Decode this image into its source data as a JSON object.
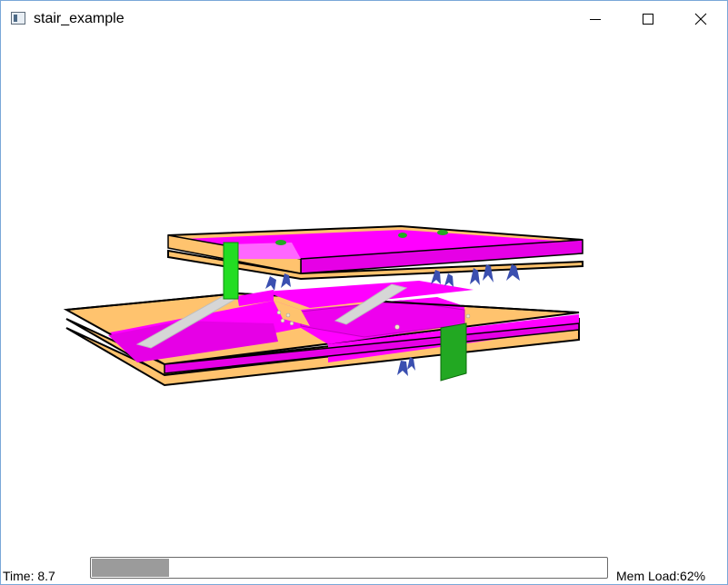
{
  "window": {
    "title": "stair_example"
  },
  "icons": {
    "app": "app-window-icon",
    "minimize": "minimize-icon",
    "maximize": "maximize-icon",
    "close": "close-icon"
  },
  "status": {
    "time_label": "Time: 8.7",
    "mem_label": "Mem Load:62%",
    "progress_fraction": 0.15
  },
  "scene": {
    "description_colors": {
      "floor_slab": "#ff00ff",
      "floor_slab_top": "#e600e6",
      "tile_orange": "#ffc36e",
      "stair_grey": "#d6d6d6",
      "door_green": "#22cc22",
      "agent_blue": "#3a4fb0",
      "outline": "#000000"
    }
  }
}
